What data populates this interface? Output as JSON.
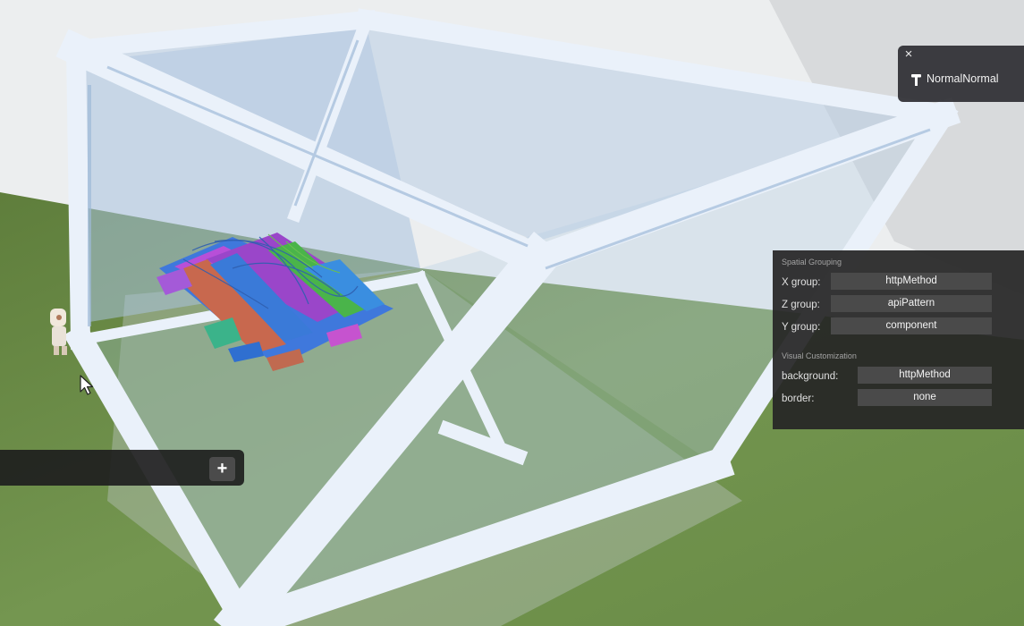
{
  "user_widget": {
    "close_icon": "×",
    "username": "NormalNormal"
  },
  "panel": {
    "spatial_heading": "Spatial Grouping",
    "x_group_label": "X group:",
    "x_group_value": "httpMethod",
    "z_group_label": "Z group:",
    "z_group_value": "apiPattern",
    "y_group_label": "Y group:",
    "y_group_value": "component",
    "visual_heading": "Visual Customization",
    "background_label": "background:",
    "background_value": "httpMethod",
    "border_label": "border:",
    "border_value": "none"
  },
  "chatbar": {
    "add_label": "+"
  },
  "colors": {
    "panel_bg": "#262626",
    "field_bg": "#4a4a4a",
    "glass_frame": "#e6eef8",
    "grass": "#6f8f48"
  }
}
